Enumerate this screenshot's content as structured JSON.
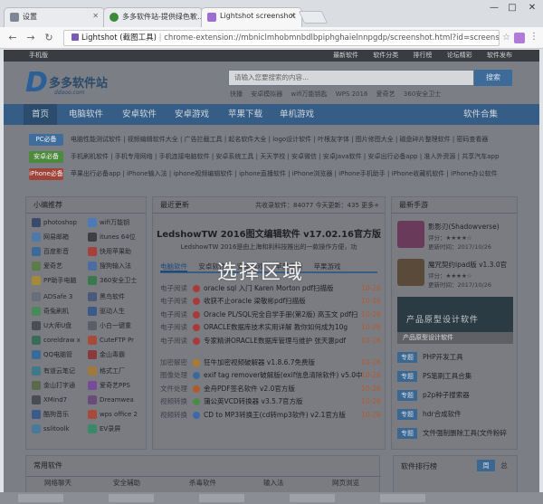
{
  "browser": {
    "tabs": [
      {
        "label": "设置",
        "active": false
      },
      {
        "label": "多多软件站-提供绿色软…",
        "active": false
      },
      {
        "label": "Lightshot screenshot",
        "active": true
      }
    ],
    "window_buttons": [
      "—",
      "□",
      "✕"
    ],
    "url_site": "Lightshot (截图工具)",
    "url": "chrome-extension://mbniclmhobmnbdlbpiphghaielnnpgdp/screenshot.html?id=screenshot_0.4841503…"
  },
  "page": {
    "topstrip": {
      "left": "手机版",
      "right": [
        "最新软件",
        "软件分类",
        "排行榜",
        "论坛精彩",
        "软件发布"
      ]
    },
    "logo": {
      "title": "多多软件站",
      "url": "ddooo.com",
      "mark": "D"
    },
    "search": {
      "placeholder": "请输入您要搜索的内容...",
      "button": "搜索"
    },
    "hot_words": [
      "快播",
      "安卓模拟器",
      "wifi万能钥匙",
      "WPS 2016",
      "爱奇艺",
      "360安全卫士"
    ],
    "nav": [
      "首页",
      "电脑软件",
      "安卓软件",
      "安卓游戏",
      "苹果下载",
      "单机游戏",
      "软件合集"
    ],
    "categories": [
      {
        "tag": "PC必备",
        "links": "电脑性能测试软件 | 视频编辑软件大全 | 广告拦截工具 | 起名软件大全 | logo设计软件 | 叶根友字体 | 图片修图大全 | 磁盘碎片整理软件 | 密码查看器"
      },
      {
        "tag": "安卓必备",
        "links": "手机刷机软件 | 手机专用网络 | 手机连接电脑软件 | 安卓系统工具 | 天天学校 | 安卓微信 | 安卓Java软件 | 安卓出行必备app | 准人外资源 | 共享汽车app"
      },
      {
        "tag": "iPhone必备",
        "links": "苹果出行必备app | iPhone输入法 | iphone视频编辑软件 | iphone直播软件 | iPhone浏览器 | iPhone手机助手 | iPhone收藏机软件 | iPhone办公软件"
      }
    ],
    "recommend": {
      "title": "小编推荐",
      "items": [
        "photoshop",
        "wifi万能钥",
        "网易邮箱",
        "itunes 64位",
        "百度影音",
        "快用苹果助",
        "爱奇艺",
        "搜狗输入法",
        "PP助手电脑",
        "360安全卫士",
        "ADSafe 3",
        "黑鸟软件",
        "奇兔刷机",
        "驱动人生",
        "U大师U盘",
        "小白一键重",
        "coreldraw x",
        "CuteFTP Pr",
        "QQ电脑管",
        "金山毒霸",
        "有道云笔记",
        "格式工厂",
        "金山打字通",
        "爱奇艺PPS",
        "XMind7",
        "Dreamwea",
        "酷狗音乐",
        "wps office 2",
        "sslitoolk",
        "EV录屏"
      ],
      "colors": [
        "#3a4a6a",
        "#4c7ab8",
        "#4f79a8",
        "#3d3f44",
        "#3b6a9a",
        "#a7403a",
        "#5a7b4a",
        "#4a6ea4",
        "#a58a3a",
        "#3a7a4a",
        "#6a6e78",
        "#4a5a7a",
        "#4a8a5a",
        "#3a5a8a",
        "#4a4c54",
        "#5a5e68",
        "#3a6a5a",
        "#a84a3a",
        "#3a6a9a",
        "#8a3a3a",
        "#3d7a8a",
        "#a07a3a",
        "#5a6a4a",
        "#7a4a9a",
        "#4a4c54",
        "#6a4c7a",
        "#3a5a8a",
        "#a84a3a",
        "#4a7a9a",
        "#3a8a6a"
      ]
    },
    "updates": {
      "title": "最近更新",
      "stats": "共收录软件：84077  今天更新：435  更多+",
      "headline": "LedshowTW 2016图文编辑软件 v17.02.16官方版",
      "subline": "LedshowTW 2016是由上海和利科技推出的一款操作方便，功",
      "tabs": [
        "电脑软件",
        "安卓软件",
        "安卓游戏",
        "苹果应用",
        "苹果游戏"
      ],
      "rows": [
        {
          "cat": "电子阅读",
          "title": "oracle sql 入门 Karen Morton pdf扫描版",
          "date": "10-26",
          "dot": "#aa3a3a"
        },
        {
          "cat": "电子阅读",
          "title": "收获不止oracle 梁敬彬pdf扫描版",
          "date": "10-26",
          "dot": "#a83a3a"
        },
        {
          "cat": "电子阅读",
          "title": "Oracle PL/SQL完全自学手册(第2版) 高玉文 pdf扫",
          "date": "10-26",
          "dot": "#a83a3a"
        },
        {
          "cat": "电子阅读",
          "title": "ORACLE数据库技术实用详解 教你如何成为10g",
          "date": "10-26",
          "dot": "#a83a3a"
        },
        {
          "cat": "电子阅读",
          "title": "专家精讲ORACLE数据库管理与维护 张天惠pdf",
          "date": "10-26",
          "dot": "#a83a3a"
        },
        {
          "cat": "加密解密",
          "title": "狂牛加密视频破解器 v1.8.6.7免费版",
          "date": "10-26",
          "dot": "#b07a2a"
        },
        {
          "cat": "图像处理",
          "title": "exif tag remover破解版(exif信息清除软件) v5.0中",
          "date": "10-26",
          "dot": "#3a6a9a"
        },
        {
          "cat": "文件处理",
          "title": "金舟PDF签名软件 v2.0官方版",
          "date": "10-26",
          "dot": "#b05a2a"
        },
        {
          "cat": "视频转换",
          "title": "蒲公英VCD转换器 v3.5.7官方版",
          "date": "10-26",
          "dot": "#4a8a4a"
        },
        {
          "cat": "视频转换",
          "title": "CD to MP3转换王(cd转mp3软件) v2.1官方版",
          "date": "10-26",
          "dot": "#3a6aa8"
        }
      ]
    },
    "games": {
      "title": "最新手游",
      "items": [
        {
          "name": "影影刃(Shadowverse)",
          "rating": "评分：★★★★☆",
          "date": "更新时间：2017/10/26",
          "color": "#6a3a5a"
        },
        {
          "name": "魔咒契约ipad版 v1.3.0官",
          "rating": "评分：★★★★☆",
          "date": "更新时间：2017/10/26",
          "color": "#5a4a3a"
        }
      ],
      "banner_title": "产品原型设计软件",
      "banner_sub": "产品原型设计软件",
      "topics_label": "专题",
      "topics": [
        "PHP开发工具",
        "PS笔刷工具合集",
        "p2p种子搜索器",
        "hdr合成软件",
        "文件强制删除工具(文件粉碎"
      ]
    },
    "overlay_text": "选择区域",
    "common": {
      "title": "常用软件",
      "cols": [
        "网络聊天",
        "安全辅助",
        "杀毒软件",
        "输入法",
        "网页浏览"
      ]
    },
    "ranking": {
      "title": "软件排行榜",
      "tabs": [
        "周",
        "总"
      ]
    }
  }
}
